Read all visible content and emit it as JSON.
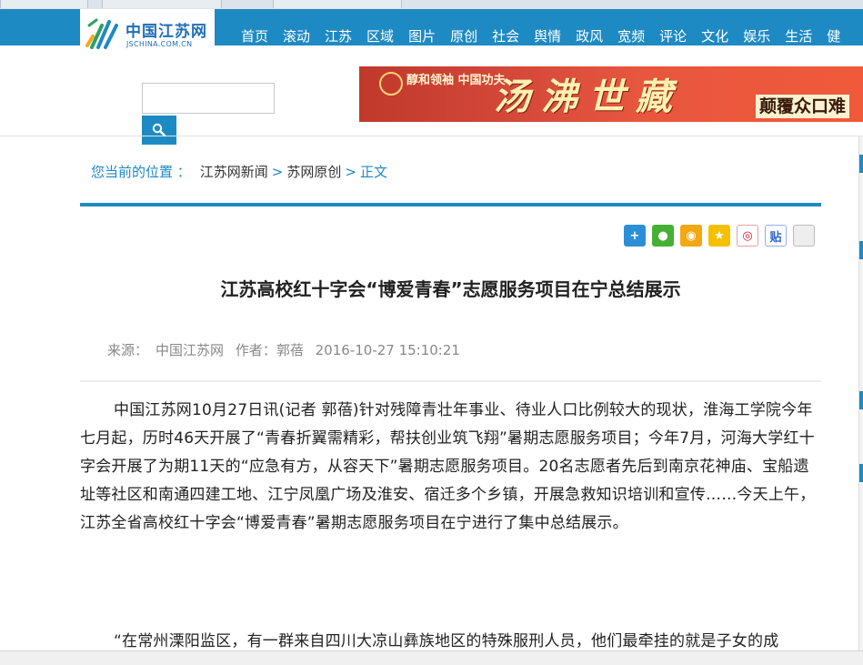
{
  "site": {
    "logo_cn": "中国江苏网",
    "logo_en": "JSCHINA.COM.CN"
  },
  "nav": {
    "items": [
      "首页",
      "滚动",
      "江苏",
      "区域",
      "图片",
      "原创",
      "社会",
      "舆情",
      "政风",
      "宽频",
      "评论",
      "文化",
      "娱乐",
      "生活",
      "健"
    ]
  },
  "search": {
    "value": "",
    "placeholder": ""
  },
  "banner": {
    "small": "醇和领袖 中国功夫",
    "big": "汤沸世藏",
    "tag": "颠覆众口难"
  },
  "breadcrumb": {
    "label": "您当前的位置 ：",
    "items": [
      "江苏网新闻",
      "苏网原创",
      "正文"
    ]
  },
  "share": {
    "buttons": [
      {
        "name": "share-plus",
        "glyph": "+",
        "color": "#2c8fd6"
      },
      {
        "name": "wechat",
        "glyph": "●",
        "color": "#46b035"
      },
      {
        "name": "qq",
        "glyph": "◉",
        "color": "#f3a712"
      },
      {
        "name": "qzone",
        "glyph": "★",
        "color": "#f6c000"
      },
      {
        "name": "weibo",
        "glyph": "◎",
        "color": "#e6162d"
      },
      {
        "name": "tieba",
        "glyph": "贴",
        "color": "#2e66c8"
      },
      {
        "name": "copy",
        "glyph": "",
        "color": "#d9d9d9"
      }
    ]
  },
  "article": {
    "title": "江苏高校红十字会“博爱青春”志愿服务项目在宁总结展示",
    "source_label": "来源：",
    "source": "中国江苏网",
    "author_label": "作者：",
    "author": "郭蓓",
    "datetime": "2016-10-27 15:10:21",
    "paragraphs": [
      "中国江苏网10月27日讯(记者 郭蓓)针对残障青壮年事业、待业人口比例较大的现状，淮海工学院今年七月起，历时46天开展了“青春折翼需精彩，帮扶创业筑飞翔”暑期志愿服务项目；今年7月，河海大学红十字会开展了为期11天的“应急有方，从容天下”暑期志愿服务项目。20名志愿者先后到南京花神庙、宝船遗址等社区和南通四建工地、江宁凤凰广场及淮安、宿迁多个乡镇，开展急救知识培训和宣传……今天上午，江苏全省高校红十字会“博爱青春”暑期志愿服务项目在宁进行了集中总结展示。",
      "“在常州溧阳监区，有一群来自四川大凉山彝族地区的特殊服刑人员，他们最牵挂的就是子女的成"
    ]
  },
  "colors": {
    "brand": "#1e8ac3",
    "text": "#222222",
    "meta": "#888888"
  }
}
